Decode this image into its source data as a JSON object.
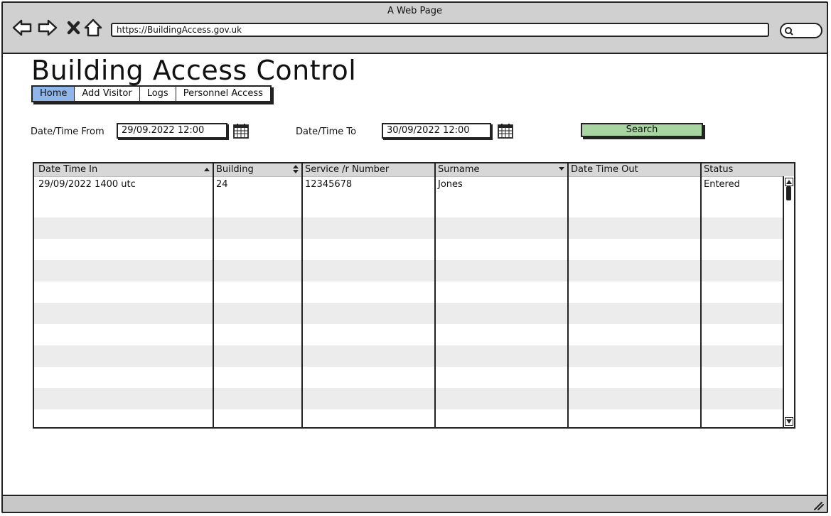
{
  "window": {
    "title": "A Web Page"
  },
  "browser": {
    "url": "https://BuildingAccess.gov.uk"
  },
  "page": {
    "title": "Building Access Control"
  },
  "tabs": [
    {
      "label": "Home",
      "active": true
    },
    {
      "label": "Add Visitor",
      "active": false
    },
    {
      "label": "Logs",
      "active": false
    },
    {
      "label": "Personnel Access",
      "active": false
    }
  ],
  "filters": {
    "from_label": "Date/Time From",
    "from_value": "29/09.2022 12:00",
    "to_label": "Date/Time To",
    "to_value": "30/09/2022 12:00",
    "search_label": "Search"
  },
  "table": {
    "columns": [
      {
        "label": "Date Time In",
        "sort": "asc"
      },
      {
        "label": "Building",
        "sort": "both"
      },
      {
        "label": "Service /r Number",
        "sort": "none"
      },
      {
        "label": "Surname",
        "sort": "desc"
      },
      {
        "label": "Date Time Out",
        "sort": "none"
      },
      {
        "label": "Status",
        "sort": "none"
      }
    ],
    "rows": [
      [
        "29/09/2022 1400 utc",
        "24",
        "12345678",
        "Jones",
        "",
        "Entered"
      ]
    ]
  },
  "colors": {
    "active_tab": "#8fb5e9",
    "search_button": "#a8d5a2",
    "alt_row": "#ececec"
  }
}
